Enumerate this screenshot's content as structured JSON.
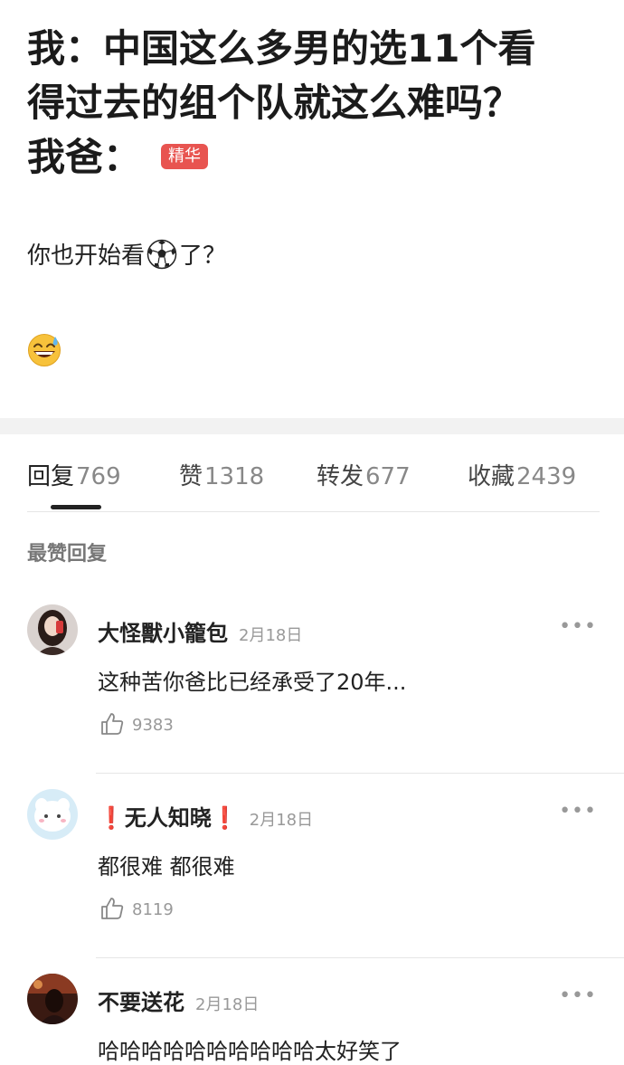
{
  "post": {
    "title_lines": [
      "我：中国这么多男的选11个看",
      "得过去的组个队就这么难吗？",
      "我爸："
    ],
    "badge": "精华",
    "body_before": "你也开始看",
    "body_after": "了？",
    "inline_icon": "soccer-ball-icon",
    "emoji": "grinning-sweat-emoji"
  },
  "tabs": [
    {
      "label": "回复",
      "count": "769"
    },
    {
      "label": "赞",
      "count": "1318"
    },
    {
      "label": "转发",
      "count": "677"
    },
    {
      "label": "收藏",
      "count": "2439"
    }
  ],
  "section_title": "最赞回复",
  "comments": [
    {
      "name": "大怪獸小籠包",
      "date": "2月18日",
      "text": "这种苦你爸比已经承受了20年...",
      "likes": "9383"
    },
    {
      "name": "无人知晓",
      "name_prefix": "❗",
      "name_suffix": "❗",
      "date": "2月18日",
      "text": "都很难 都很难",
      "likes": "8119"
    },
    {
      "name": "不要送花",
      "date": "2月18日",
      "text": "哈哈哈哈哈哈哈哈哈哈太好笑了",
      "likes": ""
    }
  ],
  "more_label": "•••",
  "colors": {
    "badge": "#e85450",
    "accent_dark": "#222222",
    "muted": "#999999",
    "separator": "#f2f2f2"
  }
}
